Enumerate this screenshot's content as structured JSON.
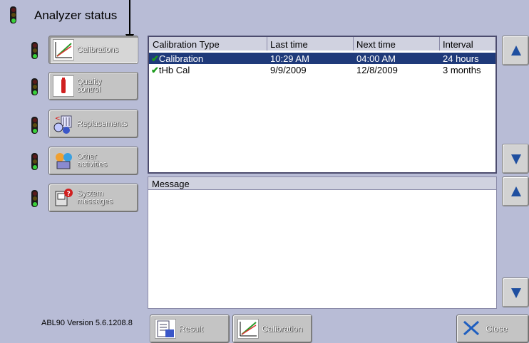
{
  "title": "Analyzer status",
  "version": "ABL90 Version 5.6.1208.8",
  "nav": [
    {
      "label_lines": [
        "Calibrations"
      ],
      "icon": "calibration-chart-icon",
      "active": true
    },
    {
      "label_lines": [
        "Quality",
        "control"
      ],
      "icon": "qc-ampoule-icon",
      "active": false
    },
    {
      "label_lines": [
        "Replacements"
      ],
      "icon": "replacements-icon",
      "active": false
    },
    {
      "label_lines": [
        "Other",
        "activities"
      ],
      "icon": "other-activities-icon",
      "active": false
    },
    {
      "label_lines": [
        "System",
        "messages"
      ],
      "icon": "system-messages-icon",
      "active": false
    }
  ],
  "table": {
    "columns": [
      "Calibration Type",
      "Last time",
      "Next time",
      "Interval"
    ],
    "rows": [
      {
        "type": "Calibration",
        "last": "10:29 AM",
        "next": "04:00 AM",
        "interval": "24 hours",
        "selected": true
      },
      {
        "type": "tHb Cal",
        "last": "9/9/2009",
        "next": "12/8/2009",
        "interval": "3 months",
        "selected": false
      }
    ]
  },
  "message_panel": {
    "header": "Message"
  },
  "bottom": {
    "result": "Result",
    "calibration": "Calibration",
    "close": "Close"
  },
  "colors": {
    "background": "#b8bcd6",
    "selected_row": "#1f3a7a",
    "arrow": "#1f4fa0",
    "status_green": "#39d13b"
  }
}
